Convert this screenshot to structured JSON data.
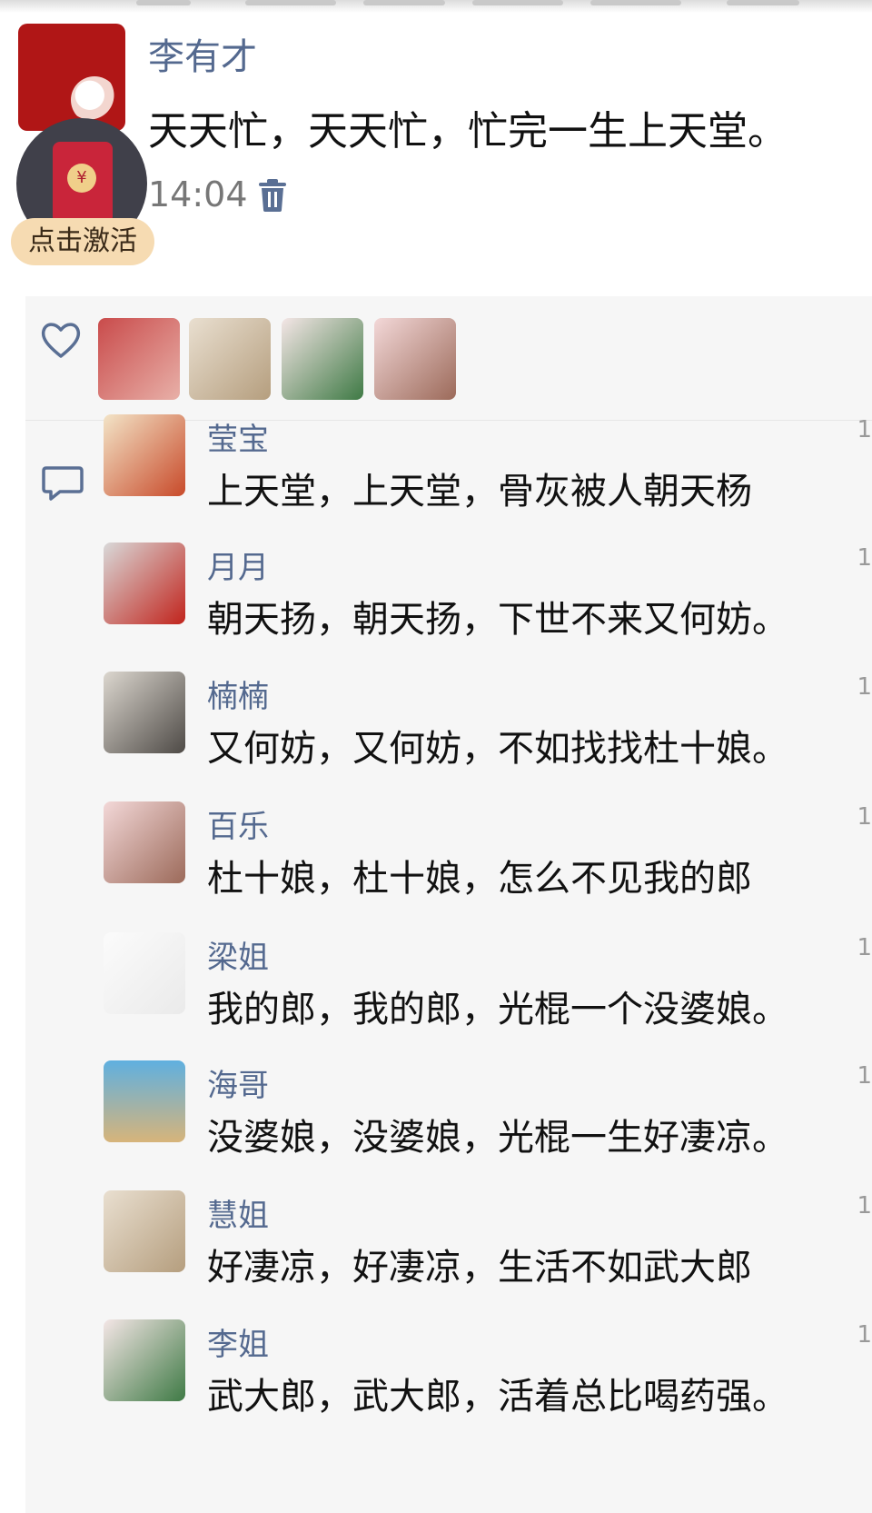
{
  "post": {
    "author": "李有才",
    "text": "天天忙，天天忙，忙完一生上天堂。",
    "time": "14:04",
    "activate_label": "点击激活",
    "redpacket_symbol": "¥"
  },
  "likes": {
    "icon": "heart-icon",
    "avatars": [
      "family-photo",
      "cat-doll",
      "flowers",
      "cartoon-girl"
    ]
  },
  "comments": [
    {
      "name": "莹宝",
      "text": "上天堂，上天堂，骨灰被人朝天杨",
      "avatar": "poster-gaoqian"
    },
    {
      "name": "月月",
      "text": "朝天扬，朝天扬，下世不来又何妨。",
      "avatar": "woman-roses"
    },
    {
      "name": "楠楠",
      "text": "又何妨，又何妨，不如找找杜十娘。",
      "avatar": "couple-sitting"
    },
    {
      "name": "百乐",
      "text": "杜十娘，杜十娘，怎么不见我的郎",
      "avatar": "cartoon-girl"
    },
    {
      "name": "梁姐",
      "text": "我的郎，我的郎，光棍一个没婆娘。",
      "avatar": "calligraphy"
    },
    {
      "name": "海哥",
      "text": "没婆娘，没婆娘，光棍一生好凄凉。",
      "avatar": "boat-beach"
    },
    {
      "name": "慧姐",
      "text": "好凄凉，好凄凉，生活不如武大郎",
      "avatar": "cat-doll"
    },
    {
      "name": "李姐",
      "text": "武大郎，武大郎，活着总比喝药强。",
      "avatar": "flowers"
    }
  ],
  "edge_mark": "1",
  "colors": {
    "name_blue": "#54698f",
    "text_black": "#111111",
    "panel_gray": "#f6f6f6",
    "redpacket_red": "#c9253a",
    "activate_bg": "#f6dbb2"
  }
}
